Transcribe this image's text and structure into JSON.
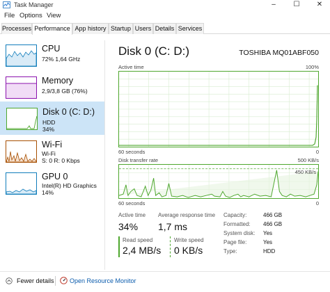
{
  "window": {
    "title": "Task Manager",
    "controls": [
      "–",
      "☐",
      "✕"
    ]
  },
  "menu": {
    "items": [
      "File",
      "Options",
      "View"
    ]
  },
  "tabs": [
    "Processes",
    "Performance",
    "App history",
    "Startup",
    "Users",
    "Details",
    "Services"
  ],
  "active_tab": "Performance",
  "colors": {
    "disk_green": "#4ea72e",
    "selected_bg": "#cce4f7",
    "cpu_blue": "#117dbb",
    "memory_purple": "#8b12ae",
    "wifi_orange": "#a74f01",
    "link_blue": "#0b5cad"
  },
  "sidebar": {
    "items": [
      {
        "name": "CPU",
        "sub1": "72% 1,64 GHz",
        "sub2": "",
        "icon": "cpu-graph-icon"
      },
      {
        "name": "Memory",
        "sub1": "2,9/3,8 GB (76%)",
        "sub2": "",
        "icon": "memory-graph-icon"
      },
      {
        "name": "Disk 0 (C: D:)",
        "sub1": "HDD",
        "sub2": "34%",
        "icon": "disk-graph-icon"
      },
      {
        "name": "Wi-Fi",
        "sub1": "Wi-Fi",
        "sub2": "S: 0 R: 0 Kbps",
        "icon": "wifi-graph-icon"
      },
      {
        "name": "GPU 0",
        "sub1": "Intel(R) HD Graphics",
        "sub2": "14%",
        "icon": "gpu-graph-icon"
      }
    ]
  },
  "main": {
    "title": "Disk 0 (C: D:)",
    "model": "TOSHIBA MQ01ABF050",
    "graph1": {
      "label": "Active time",
      "max": "100%",
      "xlabel": "60 seconds",
      "min": "0"
    },
    "graph2": {
      "label": "Disk transfer rate",
      "max": "500 KB/s",
      "mid": "450 KB/s",
      "xlabel": "60 seconds",
      "min": "0"
    },
    "stats": {
      "active_time_label": "Active time",
      "active_time": "34%",
      "avg_response_label": "Average response time",
      "avg_response": "1,7 ms",
      "read_label": "Read speed",
      "read": "2,4 MB/s",
      "write_label": "Write speed",
      "write": "0 KB/s"
    },
    "props": [
      {
        "key": "Capacity:",
        "value": "466 GB"
      },
      {
        "key": "Formatted:",
        "value": "466 GB"
      },
      {
        "key": "System disk:",
        "value": "Yes"
      },
      {
        "key": "Page file:",
        "value": "Yes"
      },
      {
        "key": "Type:",
        "value": "HDD"
      }
    ]
  },
  "footer": {
    "fewer_details": "Fewer details",
    "open_monitor": "Open Resource Monitor"
  }
}
